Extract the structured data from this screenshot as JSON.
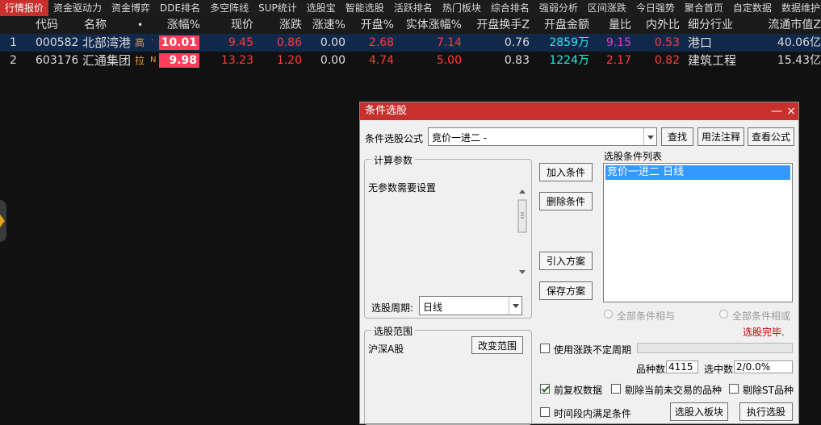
{
  "nav_tabs": [
    "行情报价",
    "资金驱动力",
    "资金博弈",
    "DDE排名",
    "多空阵线",
    "SUP统计",
    "选股宝",
    "智能选股",
    "活跃排名",
    "热门板块",
    "综合排名",
    "强弱分析",
    "区间涨跌",
    "今日强势",
    "聚合首页",
    "自定数据",
    "数据维护"
  ],
  "table": {
    "headers": [
      "",
      "代码",
      "名称",
      "•",
      "涨幅%",
      "现价",
      "涨跌",
      "涨速%",
      "开盘%",
      "实体涨幅%",
      "开盘换手Z",
      "开盘金额",
      "量比",
      "内外比",
      "细分行业",
      "流通市值Z"
    ],
    "rows": [
      {
        "idx": "1",
        "code": "000582",
        "name": "北部湾港",
        "tag": "高",
        "flag": "'",
        "pct": "10.01",
        "price": "9.45",
        "chg": "0.86",
        "speed": "0.00",
        "open_pct": "2.68",
        "body_pct": "7.14",
        "open_turn": "0.76",
        "open_amt": "2859万",
        "vol_ratio": "9.15",
        "io_ratio": "0.53",
        "industry": "港口",
        "float_cap": "40.06亿"
      },
      {
        "idx": "2",
        "code": "603176",
        "name": "汇通集团",
        "tag": "拉",
        "flag": "N",
        "pct": "9.98",
        "price": "13.23",
        "chg": "1.20",
        "speed": "0.00",
        "open_pct": "4.74",
        "body_pct": "5.00",
        "open_turn": "0.83",
        "open_amt": "1224万",
        "vol_ratio": "2.17",
        "io_ratio": "0.82",
        "industry": "建筑工程",
        "float_cap": "15.43亿"
      }
    ]
  },
  "dialog": {
    "title": "条件选股",
    "minimize": "—",
    "close": "×",
    "formula_label": "条件选股公式",
    "formula_value": "竞价一进二   -",
    "find_btn": "查找",
    "usage_btn": "用法注释",
    "view_btn": "查看公式",
    "params_group": "计算参数",
    "params_text": "无参数需要设置",
    "period_label": "选股周期:",
    "period_value": "日线",
    "add_btn": "加入条件",
    "del_btn": "删除条件",
    "import_btn": "引入方案",
    "save_btn": "保存方案",
    "cond_list_label": "选股条件列表",
    "cond_items": [
      "竞价一进二  日线"
    ],
    "radio_and": "全部条件相与",
    "radio_or": "全部条件相或",
    "status": "选股完毕.",
    "range_group": "选股范围",
    "range_value": "沪深A股",
    "change_range_btn": "改变范围",
    "use_period_label": "使用涨跌不定周期",
    "count_label": "品种数",
    "count_value": "4115",
    "selected_label": "选中数",
    "selected_value": "2/0.0%",
    "adj_label": "前复权数据",
    "excl_untraded_label": "剔除当前未交易的品种",
    "excl_st_label": "剔除ST品种",
    "interval_label": "时间段内满足条件",
    "to_block_btn": "选股入板块",
    "run_btn": "执行选股"
  },
  "colors": {
    "up": "#ff3c3c",
    "accent": "#c8302d",
    "cyan": "#2ee6e6",
    "magenta": "#d040d0",
    "yellow": "#f0e040"
  }
}
